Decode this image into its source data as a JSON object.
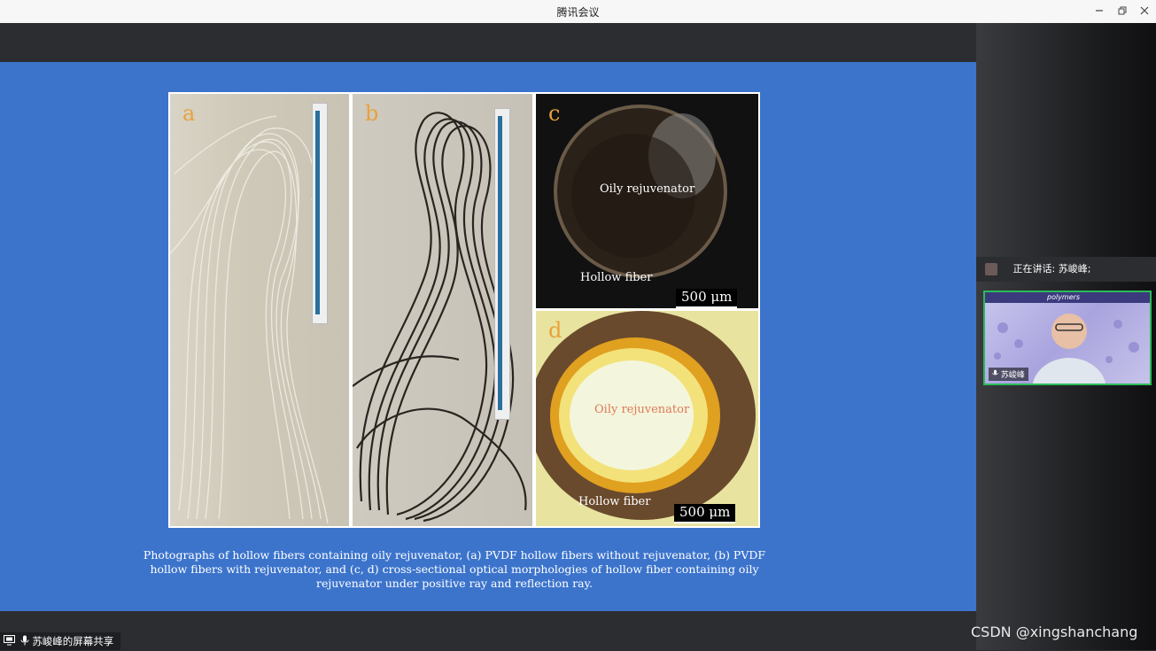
{
  "window": {
    "title": "腾讯会议"
  },
  "figure": {
    "panels": [
      {
        "label": "a"
      },
      {
        "label": "b"
      },
      {
        "label": "c",
        "inner_text": "Oily rejuvenator",
        "outer_text": "Hollow fiber",
        "scale": "500 μm"
      },
      {
        "label": "d",
        "inner_text": "Oily rejuvenator",
        "outer_text": "Hollow fiber",
        "scale": "500 μm"
      }
    ],
    "caption": "Photographs of hollow fibers containing oily rejuvenator, (a) PVDF hollow fibers without rejuvenator, (b) PVDF hollow fibers with rejuvenator, and (c, d) cross-sectional optical morphologies of hollow fiber containing oily rejuvenator under positive ray and reflection ray."
  },
  "sharer": {
    "label": "苏峻峰的屏幕共享"
  },
  "sidebar": {
    "speaking_label": "正在讲话: 苏峻峰;",
    "participant_name": "苏峻峰",
    "video_banner": "polymers"
  },
  "watermark": "CSDN @xingshanchang",
  "colors": {
    "slide_bg": "#3c74cc",
    "active_border": "#2bbb5a"
  },
  "icons": [
    "minimize-icon",
    "restore-icon",
    "close-icon",
    "screen-share-icon",
    "mic-icon",
    "speaker-avatar-icon"
  ]
}
